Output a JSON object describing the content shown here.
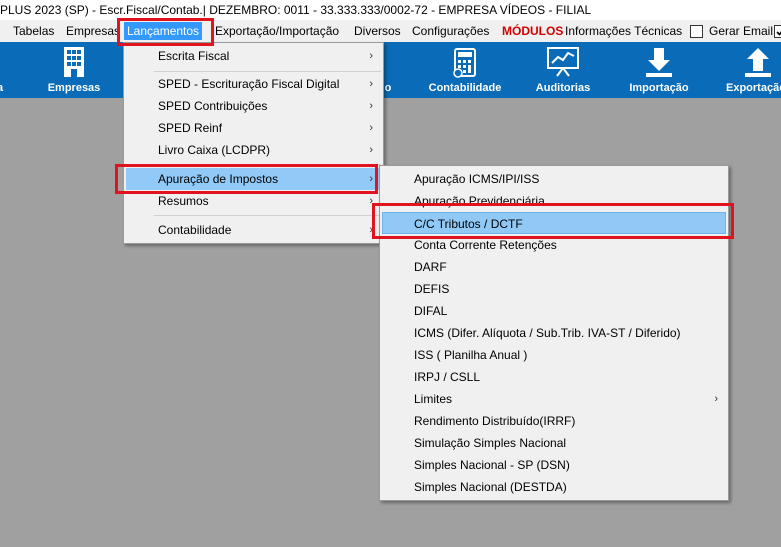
{
  "window": {
    "title": "PLUS 2023 (SP) - Escr.Fiscal/Contab.| DEZEMBRO: 0011 - 33.333.333/0002-72 - EMPRESA VÍDEOS - FILIAL"
  },
  "menubar": {
    "items": [
      "Tabelas",
      "Empresas",
      "Lançamentos",
      "Exportação/Importação",
      "Diversos",
      "Configurações",
      "MÓDULOS",
      "Informações Técnicas"
    ],
    "gerar_email_label": "Gerar Email"
  },
  "toolbar": {
    "buttons": [
      {
        "label": "a",
        "icon": "partial-icon"
      },
      {
        "label": "Empresas",
        "icon": "building-icon"
      },
      {
        "label": "o",
        "icon": "partial-icon"
      },
      {
        "label": "Contabilidade",
        "icon": "calculator-icon"
      },
      {
        "label": "Auditorias",
        "icon": "chart-board-icon"
      },
      {
        "label": "Importação",
        "icon": "download-arrow-icon"
      },
      {
        "label": "Exportação",
        "icon": "upload-arrow-icon"
      }
    ]
  },
  "lancamentos_menu": {
    "items": [
      {
        "label": "Escrita Fiscal",
        "submenu": true
      },
      {
        "label": "SPED - Escrituração Fiscal Digital",
        "submenu": true
      },
      {
        "label": "SPED Contribuições",
        "submenu": true
      },
      {
        "label": "SPED Reinf",
        "submenu": true
      },
      {
        "label": "Livro Caixa (LCDPR)",
        "submenu": true
      },
      {
        "label": "Apuração de Impostos",
        "submenu": true
      },
      {
        "label": "Resumos",
        "submenu": true
      },
      {
        "label": "Contabilidade",
        "submenu": true
      }
    ],
    "selected": "Apuração de Impostos"
  },
  "apuracao_menu": {
    "items": [
      {
        "label": "Apuração ICMS/IPI/ISS"
      },
      {
        "label": "Apuração Previdenciária"
      },
      {
        "label": "C/C Tributos / DCTF"
      },
      {
        "label": "Conta Corrente Retenções"
      },
      {
        "label": "DARF"
      },
      {
        "label": "DEFIS"
      },
      {
        "label": "DIFAL"
      },
      {
        "label": "ICMS (Difer. Alíquota / Sub.Trib. IVA-ST / Diferido)"
      },
      {
        "label": "ISS ( Planilha Anual )"
      },
      {
        "label": "IRPJ / CSLL"
      },
      {
        "label": "Limites",
        "submenu": true
      },
      {
        "label": "Rendimento Distribuído(IRRF)"
      },
      {
        "label": "Simulação Simples Nacional"
      },
      {
        "label": "Simples Nacional - SP (DSN)"
      },
      {
        "label": "Simples Nacional  (DESTDA)"
      }
    ],
    "selected": "C/C Tributos / DCTF"
  },
  "colors": {
    "toolbar_bg": "#0a6cb8",
    "highlight": "#e0131e",
    "menu_selection": "#91c9f7",
    "modulos": "#d40000"
  }
}
